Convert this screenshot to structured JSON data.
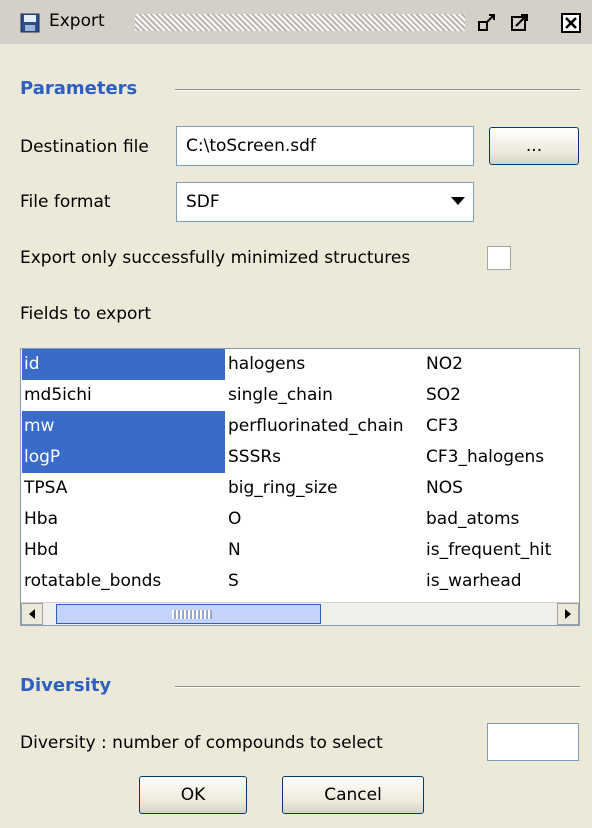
{
  "window": {
    "title": "Export",
    "icons": [
      "floppy-disk-icon",
      "undock-icon",
      "maximize-icon",
      "close-icon"
    ]
  },
  "parameters": {
    "header": "Parameters",
    "destination_label": "Destination file",
    "destination_value": "C:\\toScreen.sdf",
    "browse_label": "...",
    "format_label": "File format",
    "format_value": "SDF",
    "minimized_label": "Export only successfully minimized structures",
    "minimized_checked": false,
    "fields_label": "Fields to export"
  },
  "fields": {
    "columns": [
      [
        {
          "text": "id",
          "selected": true
        },
        {
          "text": "md5ichi",
          "selected": false
        },
        {
          "text": "mw",
          "selected": true
        },
        {
          "text": "logP",
          "selected": true
        },
        {
          "text": "TPSA",
          "selected": false
        },
        {
          "text": "Hba",
          "selected": false
        },
        {
          "text": "Hbd",
          "selected": false
        },
        {
          "text": "rotatable_bonds",
          "selected": false
        }
      ],
      [
        {
          "text": "halogens",
          "selected": false
        },
        {
          "text": "single_chain",
          "selected": false
        },
        {
          "text": "perfluorinated_chain",
          "selected": false
        },
        {
          "text": "SSSRs",
          "selected": false
        },
        {
          "text": "big_ring_size",
          "selected": false
        },
        {
          "text": "O",
          "selected": false
        },
        {
          "text": "N",
          "selected": false
        },
        {
          "text": "S",
          "selected": false
        }
      ],
      [
        {
          "text": "NO2",
          "selected": false
        },
        {
          "text": "SO2",
          "selected": false
        },
        {
          "text": "CF3",
          "selected": false
        },
        {
          "text": "CF3_halogens",
          "selected": false
        },
        {
          "text": "NOS",
          "selected": false
        },
        {
          "text": "bad_atoms",
          "selected": false
        },
        {
          "text": "is_frequent_hit",
          "selected": false
        },
        {
          "text": "is_warhead",
          "selected": false
        }
      ]
    ]
  },
  "diversity": {
    "header": "Diversity",
    "count_label": "Diversity : number of compounds to select",
    "count_value": ""
  },
  "actions": {
    "ok_label": "OK",
    "cancel_label": "Cancel"
  },
  "colors": {
    "selection": "#3a6bc9",
    "section_header": "#2d5fc0",
    "dialog_background": "#ece9d8"
  }
}
